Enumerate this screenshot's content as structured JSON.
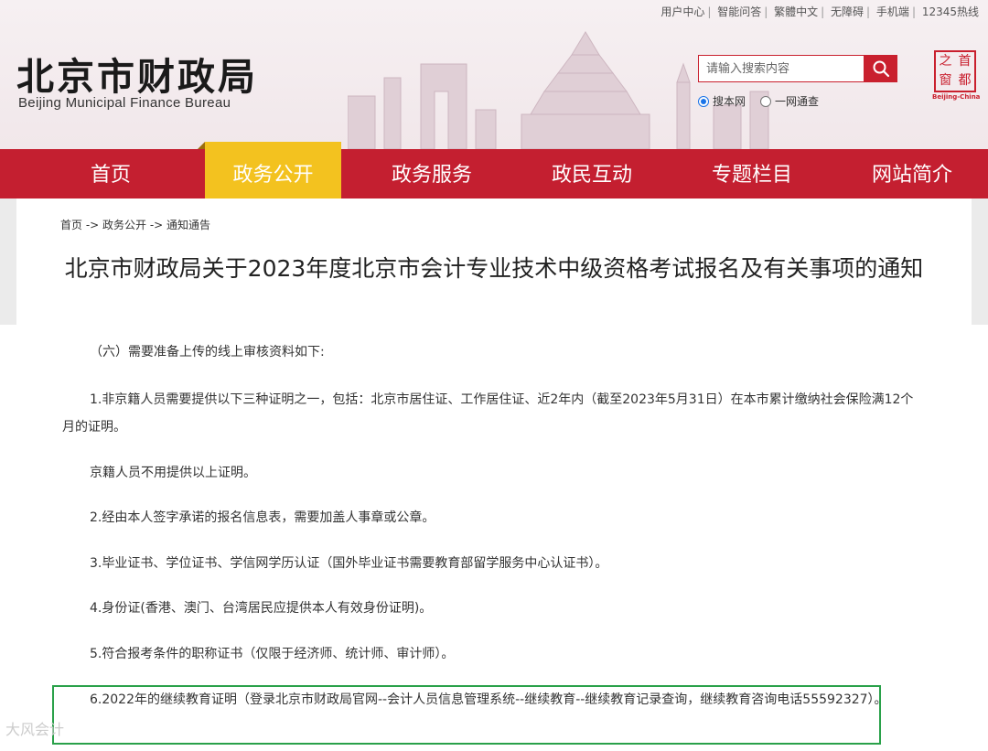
{
  "header": {
    "top_links": [
      "用户中心",
      "智能问答",
      "繁體中文",
      "无障碍",
      "手机端",
      "12345热线"
    ],
    "logo_cn": "北京市财政局",
    "logo_en": "Beijing Municipal Finance Bureau",
    "search": {
      "placeholder": "请输入搜索内容",
      "icon": "search-icon"
    },
    "search_scope": [
      {
        "label": "搜本网",
        "selected": true
      },
      {
        "label": "一网通查",
        "selected": false
      }
    ],
    "seal": {
      "chars": [
        "首",
        "都",
        "之",
        "窗"
      ],
      "en": "Beijing-China"
    },
    "colors": {
      "brand_red": "#c41f30",
      "active_yellow": "#f3c21f",
      "highlight_green": "#2aa14a"
    }
  },
  "nav": {
    "items": [
      "首页",
      "政务公开",
      "政务服务",
      "政民互动",
      "专题栏目",
      "网站简介"
    ],
    "active": "政务公开"
  },
  "breadcrumb": "首页 -> 政务公开 -> 通知通告",
  "title": "北京市财政局关于2023年度北京市会计专业技术中级资格考试报名及有关事项的通知",
  "content": {
    "paragraphs": [
      "（六）需要准备上传的线上审核资料如下:",
      "1.非京籍人员需要提供以下三种证明之一，包括：北京市居住证、工作居住证、近2年内（截至2023年5月31日）在本市累计缴纳社会保险满12个月的证明。",
      "京籍人员不用提供以上证明。",
      "2.经由本人签字承诺的报名信息表，需要加盖人事章或公章。",
      "3.毕业证书、学位证书、学信网学历认证（国外毕业证书需要教育部留学服务中心认证书）。",
      "4.身份证(香港、澳门、台湾居民应提供本人有效身份证明)。",
      "5.符合报考条件的职称证书（仅限于经济师、统计师、审计师）。",
      "6.2022年的继续教育证明（登录北京市财政局官网--会计人员信息管理系统--继续教育--继续教育记录查询，继续教育咨询电话55592327）。"
    ]
  },
  "watermark": "大风会计"
}
